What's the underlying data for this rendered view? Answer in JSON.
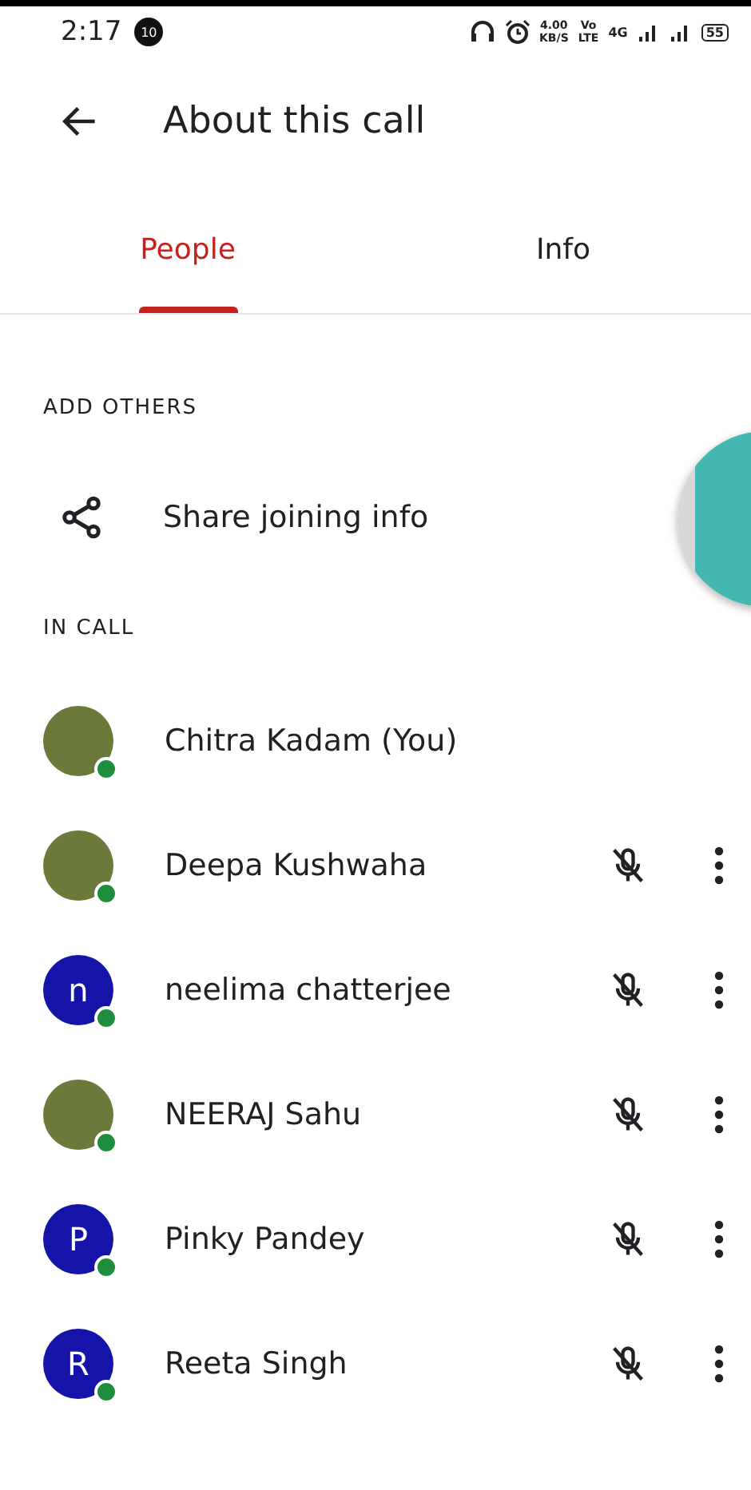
{
  "status_bar": {
    "time": "2:17",
    "notification_count": "10",
    "net_speed": "4.00",
    "net_unit": "KB/S",
    "volte_top": "Vo",
    "volte_bottom": "LTE",
    "network": "4G",
    "battery": "55"
  },
  "header": {
    "title": "About this call"
  },
  "tabs": [
    {
      "label": "People",
      "selected": true
    },
    {
      "label": "Info",
      "selected": false
    }
  ],
  "add_others": {
    "heading": "ADD OTHERS",
    "share_label": "Share joining info"
  },
  "in_call": {
    "heading": "IN CALL",
    "participants": [
      {
        "name": "Chitra Kadam (You)",
        "kind": "photo",
        "muted": false,
        "has_menu": false,
        "online": true
      },
      {
        "name": "Deepa Kushwaha",
        "kind": "photo",
        "muted": true,
        "has_menu": true,
        "online": true
      },
      {
        "name": "neelima chatterjee",
        "kind": "letter",
        "initial": "n",
        "muted": true,
        "has_menu": true,
        "online": true
      },
      {
        "name": "NEERAJ Sahu",
        "kind": "photo",
        "muted": true,
        "has_menu": true,
        "online": true
      },
      {
        "name": "Pinky Pandey",
        "kind": "letter",
        "initial": "P",
        "muted": true,
        "has_menu": true,
        "online": true
      },
      {
        "name": "Reeta Singh",
        "kind": "letter",
        "initial": "R",
        "muted": true,
        "has_menu": true,
        "online": true
      }
    ]
  }
}
